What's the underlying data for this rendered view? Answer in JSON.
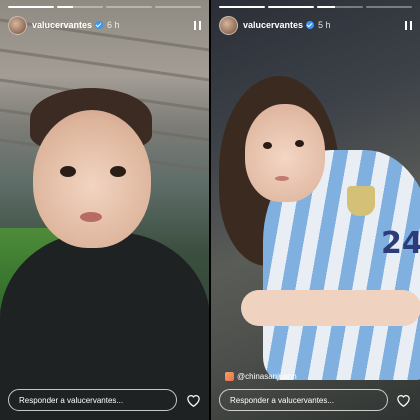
{
  "stories": [
    {
      "username": "valucervantes",
      "time": "6 h",
      "reply_placeholder": "Responder a valucervantes...",
      "progress": [
        1,
        0.35,
        0,
        0
      ]
    },
    {
      "username": "valucervantes",
      "time": "5 h",
      "reply_placeholder": "Responder a valucervantes...",
      "mention": "@chinasanjuann",
      "progress": [
        1,
        1,
        0.4,
        0
      ]
    }
  ],
  "icons": {
    "pause": "pause-icon",
    "heart": "heart-icon",
    "verified": "verified-badge-icon"
  },
  "colors": {
    "verified": "#3897f0",
    "text": "#ffffff"
  }
}
